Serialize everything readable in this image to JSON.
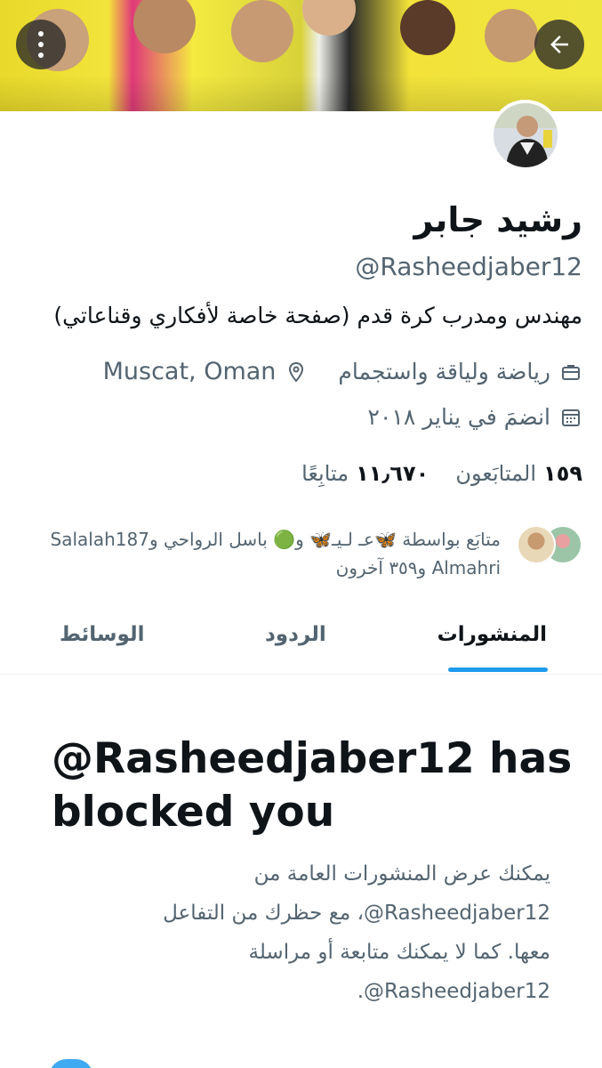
{
  "banner": {
    "label": "banner-image"
  },
  "profile": {
    "name": "رشيد جابر",
    "handle": "@Rasheedjaber12",
    "bio": "مهندس ومدرب كرة قدم (صفحة خاصة لأفكاري وقناعاتي)",
    "category": "رياضة ولياقة واستجمام",
    "location": "Muscat, Oman",
    "joined": "انضمَ في يناير ٢٠١٨",
    "following_count": "١٥٩",
    "following_label": "المتابَعون",
    "followers_count": "١١٫٦٧٠",
    "followers_label": "متابِعًا",
    "followed_by": "متابَع بواسطة 🦋عـ لـيـ🦋 و🟢 باسل الرواحي وSalalah187 Almahri و٣٥٩ آخرون"
  },
  "icons": {
    "menu": "more-vertical-icon",
    "back": "arrow-left-icon",
    "category": "briefcase-icon",
    "location": "location-pin-icon",
    "calendar": "calendar-icon"
  },
  "tabs": [
    {
      "label": "المنشورات",
      "active": true
    },
    {
      "label": "الردود",
      "active": false
    },
    {
      "label": "الوسائط",
      "active": false
    }
  ],
  "blocked": {
    "title": "@Rasheedjaber12 has blocked you",
    "description": "يمكنك عرض المنشورات العامة من ‎@Rasheedjaber12‏، مع حظرك من التفاعل معها. كما لا يمكنك متابعة أو مراسلة ‎@Rasheedjaber12‏."
  },
  "colors": {
    "accent": "#1d9bf0",
    "text": "#0f1419",
    "secondary": "#536471"
  }
}
